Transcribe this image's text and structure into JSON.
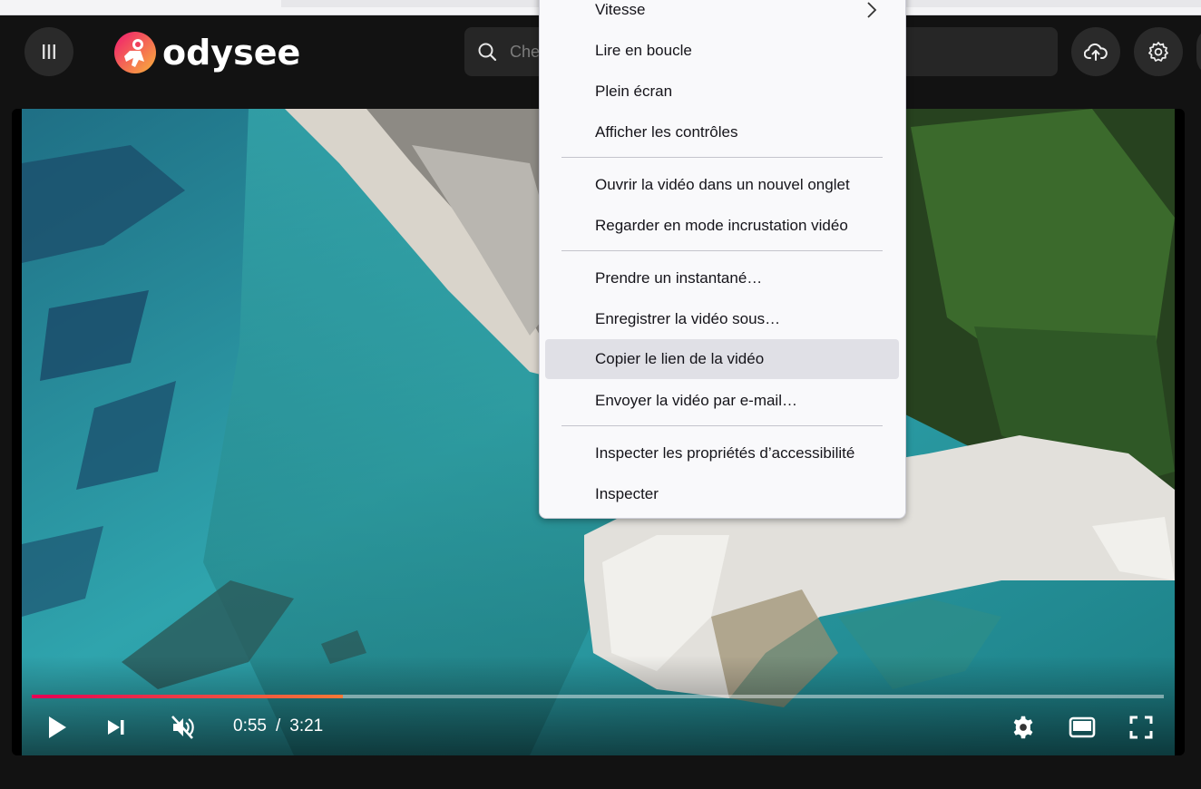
{
  "header": {
    "logo_text": "odysee",
    "search_placeholder": "Chercher"
  },
  "player": {
    "current_time": "0:55",
    "separator": "/",
    "duration": "3:21",
    "progress_fraction": 0.275,
    "accent_start": "#e50054",
    "accent_end": "#f77937"
  },
  "context_menu": {
    "items": [
      {
        "label": "Vitesse",
        "submenu": true
      },
      {
        "label": "Lire en boucle"
      },
      {
        "label": "Plein écran"
      },
      {
        "label": "Afficher les contrôles"
      },
      {
        "label": "Ouvrir la vidéo dans un nouvel onglet"
      },
      {
        "label": "Regarder en mode incrustation vidéo"
      },
      {
        "label": "Prendre un instantané…"
      },
      {
        "label": "Enregistrer la vidéo sous…"
      },
      {
        "label": "Copier le lien de la vidéo",
        "highlighted": true
      },
      {
        "label": "Envoyer la vidéo par e-mail…"
      },
      {
        "label": "Inspecter les propriétés d’accessibilité"
      },
      {
        "label": "Inspecter"
      }
    ]
  },
  "icons": {
    "menu": "menu-icon",
    "search": "search-icon",
    "upload": "cloud-upload-icon",
    "settings": "gear-icon",
    "play": "play-icon",
    "next": "skip-next-icon",
    "mute": "volume-muted-icon",
    "player_settings": "gear-icon",
    "theater": "theater-mode-icon",
    "fullscreen": "fullscreen-icon"
  }
}
